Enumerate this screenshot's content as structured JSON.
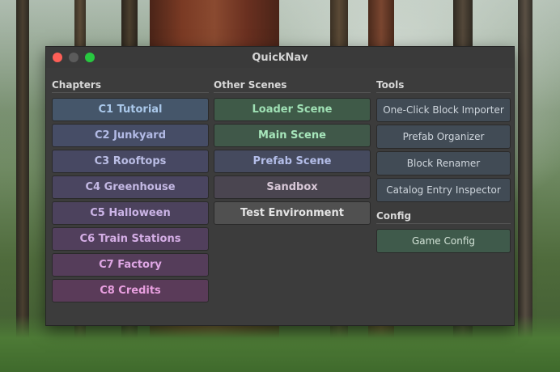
{
  "window": {
    "title": "QuickNav"
  },
  "chapters": {
    "label": "Chapters",
    "items": [
      {
        "label": "C1 Tutorial",
        "bg": "#45566a",
        "color": "#aac8ea"
      },
      {
        "label": "C2 Junkyard",
        "bg": "#464d66",
        "color": "#b3bbe6"
      },
      {
        "label": "C3 Rooftops",
        "bg": "#474862",
        "color": "#babde4"
      },
      {
        "label": "C4 Greenhouse",
        "bg": "#4a4560",
        "color": "#c4b9e4"
      },
      {
        "label": "C5 Halloween",
        "bg": "#4c425d",
        "color": "#cbb4e6"
      },
      {
        "label": "C6 Train Stations",
        "bg": "#513f5c",
        "color": "#d5aee6"
      },
      {
        "label": "C7 Factory",
        "bg": "#553d5a",
        "color": "#dea6e4"
      },
      {
        "label": "C8 Credits",
        "bg": "#5a3b59",
        "color": "#e89fdf"
      }
    ]
  },
  "other_scenes": {
    "label": "Other Scenes",
    "items": [
      {
        "label": "Loader Scene",
        "bg": "#3f5a48",
        "color": "#9fe0b4"
      },
      {
        "label": "Main Scene",
        "bg": "#405849",
        "color": "#a7e6bb"
      },
      {
        "label": "Prefab Scene",
        "bg": "#454a5e",
        "color": "#b3bde8"
      },
      {
        "label": "Sandbox",
        "bg": "#4a4550",
        "color": "#d8c8d8"
      },
      {
        "label": "Test Environment",
        "bg": "#505050",
        "color": "#e4e4e4"
      }
    ]
  },
  "tools": {
    "label": "Tools",
    "items": [
      {
        "label": "One-Click Block Importer"
      },
      {
        "label": "Prefab Organizer"
      },
      {
        "label": "Block Renamer"
      },
      {
        "label": "Catalog Entry Inspector"
      }
    ]
  },
  "config": {
    "label": "Config",
    "button": "Game Config"
  }
}
